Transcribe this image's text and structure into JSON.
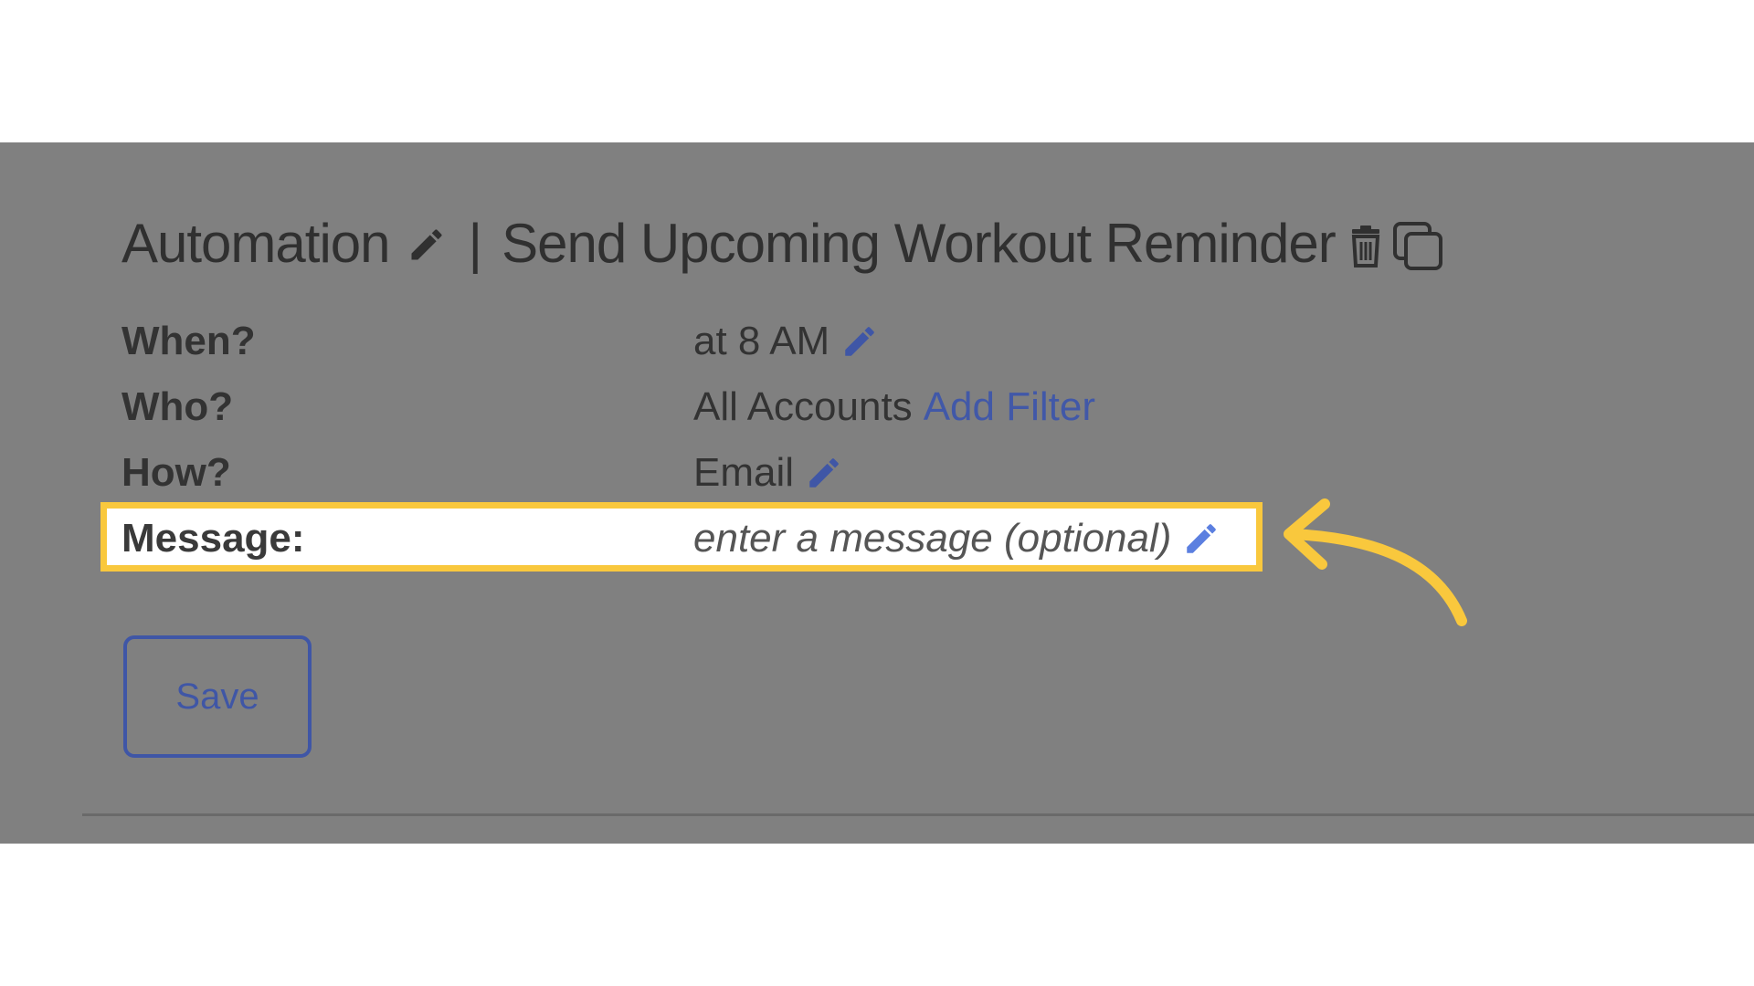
{
  "title": {
    "prefix": "Automation",
    "separator": "|",
    "name": "Send Upcoming Workout Reminder"
  },
  "fields": {
    "when": {
      "label": "When?",
      "value": "at 8 AM"
    },
    "who": {
      "label": "Who?",
      "value": "All Accounts",
      "link": "Add Filter"
    },
    "how": {
      "label": "How?",
      "value": "Email"
    },
    "message": {
      "label": "Message:",
      "placeholder": "enter a message (optional)"
    }
  },
  "actions": {
    "save_label": "Save"
  },
  "icons": {
    "title_edit": "pencil-icon",
    "delete": "trash-icon",
    "duplicate": "copy-icon",
    "field_edit": "pencil-icon",
    "annotation": "curved-arrow-icon"
  },
  "colors": {
    "overlay": "#808080",
    "highlight": "#f9c83d",
    "link": "#4158a8",
    "accent": "#3f56a6"
  }
}
